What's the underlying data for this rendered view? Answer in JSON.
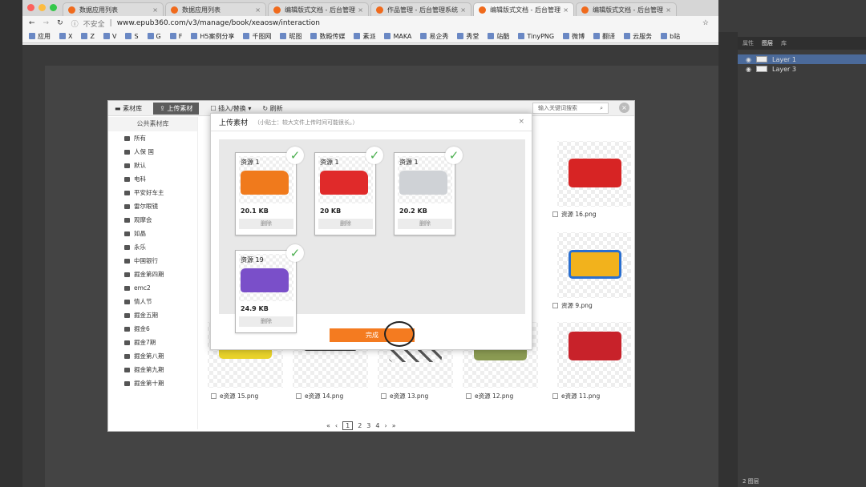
{
  "browser": {
    "tabs": [
      {
        "label": "数据应用列表",
        "active": false
      },
      {
        "label": "数据应用列表",
        "active": false
      },
      {
        "label": "编辑版式文档 - 后台管理",
        "active": false
      },
      {
        "label": "作品管理 - 后台管理系统",
        "active": false
      },
      {
        "label": "编辑版式文档 - 后台管理",
        "active": true
      },
      {
        "label": "编辑版式文档 - 后台管理",
        "active": false
      }
    ],
    "security_label": "不安全",
    "url": "www.epub360.com/v3/manage/book/xeaosw/interaction",
    "bookmarks": [
      "应用",
      "X",
      "Z",
      "V",
      "S",
      "G",
      "F",
      "H5案例分享",
      "千图网",
      "昵图",
      "数殿传媒",
      "素派",
      "MAKA",
      "易企秀",
      "秀堂",
      "站酷",
      "TinyPNG",
      "微博",
      "翻译",
      "云服务",
      "b站"
    ]
  },
  "layers_panel": {
    "tabs": [
      "属性",
      "图层",
      "库"
    ],
    "layers": [
      {
        "name": "Layer 1",
        "selected": true
      },
      {
        "name": "Layer 3",
        "selected": false
      }
    ],
    "footer": "2 图层"
  },
  "library": {
    "title": "素材库",
    "upload_button": "上传素材",
    "insert_label": "插入/替换",
    "refresh_label": "刷新",
    "search_placeholder": "输入关键词搜索",
    "public_library": "公共素材库",
    "folders": [
      "所有",
      "人保 国",
      "默认",
      "电科",
      "平安好车主",
      "雷尔眼镜",
      "观摩会",
      "如晶",
      "永乐",
      "中国银行",
      "掘金第四期",
      "emc2",
      "情人节",
      "掘金五期",
      "掘金6",
      "掘金7期",
      "掘金第八期",
      "掘金第九期",
      "掘金第十期"
    ],
    "items": [
      "资源 16.png",
      "资源 9.png",
      "e资源 15.png",
      "e资源 14.png",
      "e资源 13.png",
      "e资源 12.png",
      "e资源 11.png"
    ],
    "pagination": {
      "prev2": "«",
      "prev": "‹",
      "pages": [
        "1",
        "2",
        "3",
        "4"
      ],
      "current": "1",
      "next": "›",
      "next2": "»"
    }
  },
  "upload_dialog": {
    "title": "上传素材",
    "tip": "（小贴士：较大文件上传时间可能很长。）",
    "close": "×",
    "files": [
      {
        "name": "资源 1",
        "size": "20.1 KB",
        "color": "#f07a1c"
      },
      {
        "name": "资源 1",
        "size": "20 KB",
        "color": "#e02a2a"
      },
      {
        "name": "资源 1",
        "size": "20.2 KB",
        "color": "#cfd2d6"
      },
      {
        "name": "资源 19",
        "size": "24.9 KB",
        "color": "#7a4fc9"
      }
    ],
    "delete_label": "删除",
    "done_label": "完成"
  },
  "colors": {
    "accent": "#f47b20",
    "check": "#4caf50"
  }
}
